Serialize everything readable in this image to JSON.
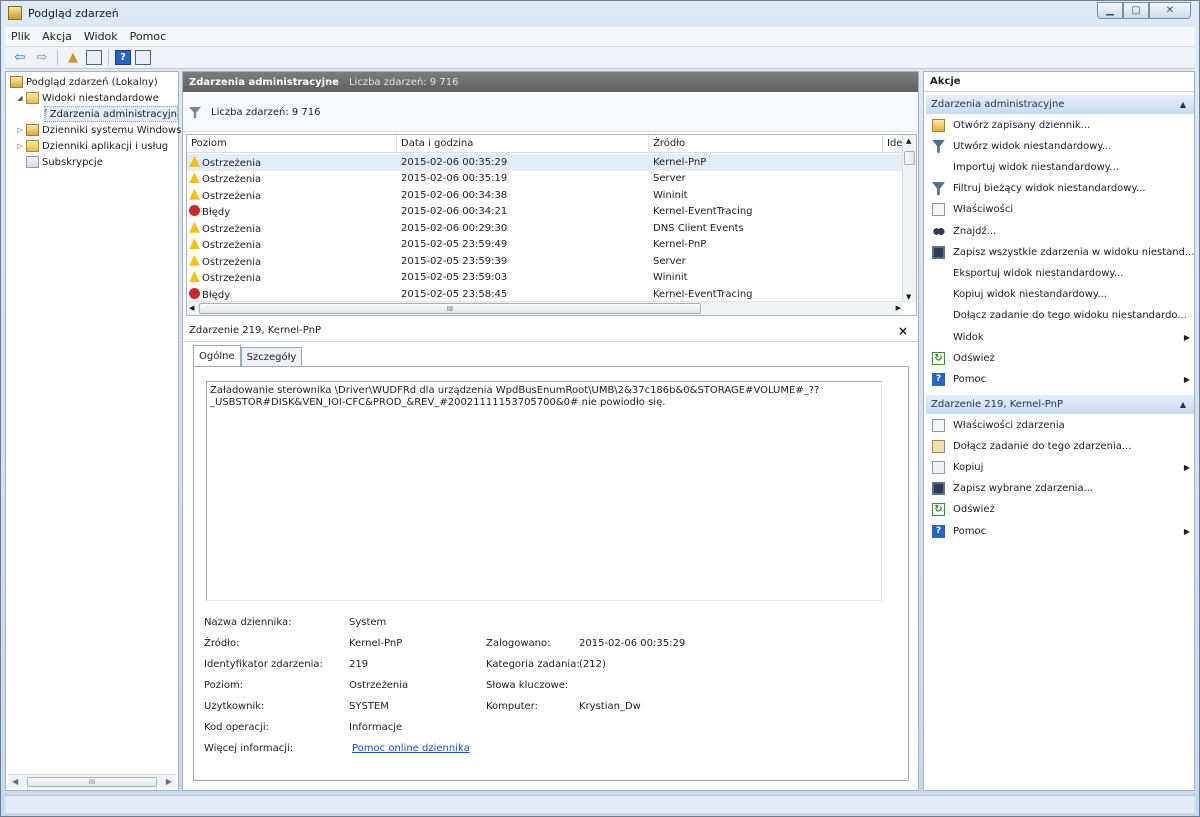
{
  "window": {
    "title": "Podgląd zdarzeń"
  },
  "menubar": [
    {
      "label": "Plik"
    },
    {
      "label": "Akcja"
    },
    {
      "label": "Widok"
    },
    {
      "label": "Pomoc"
    }
  ],
  "tree": {
    "root": "Podgląd zdarzeń (Lokalny)",
    "custom_views": "Widoki niestandardowe",
    "admin_events": "Zdarzenia administracyjn",
    "windows_logs": "Dzienniki systemu Windows",
    "app_logs": "Dzienniki aplikacji i usług",
    "subscriptions": "Subskrypcje",
    "scroll_thumb": "III"
  },
  "middle": {
    "header_title": "Zdarzenia administracyjne",
    "header_count": "Liczba zdarzeń: 9 716",
    "filter_count": "Liczba zdarzeń: 9 716"
  },
  "events": {
    "columns": [
      "Poziom",
      "Data i godzina",
      "Źródło",
      "Ide"
    ],
    "rows": [
      {
        "level": "Ostrzeżenia",
        "type": "warn",
        "date": "2015-02-06 00:35:29",
        "source": "Kernel-PnP"
      },
      {
        "level": "Ostrzeżenia",
        "type": "warn",
        "date": "2015-02-06 00:35:19",
        "source": "Server"
      },
      {
        "level": "Ostrzeżenia",
        "type": "warn",
        "date": "2015-02-06 00:34:38",
        "source": "Wininit"
      },
      {
        "level": "Błędy",
        "type": "err",
        "date": "2015-02-06 00:34:21",
        "source": "Kernel-EventTracing"
      },
      {
        "level": "Ostrzeżenia",
        "type": "warn",
        "date": "2015-02-06 00:29:30",
        "source": "DNS Client Events"
      },
      {
        "level": "Ostrzeżenia",
        "type": "warn",
        "date": "2015-02-05 23:59:49",
        "source": "Kernel-PnP"
      },
      {
        "level": "Ostrzeżenia",
        "type": "warn",
        "date": "2015-02-05 23:59:39",
        "source": "Server"
      },
      {
        "level": "Ostrzeżenia",
        "type": "warn",
        "date": "2015-02-05 23:59:03",
        "source": "Wininit"
      },
      {
        "level": "Błędy",
        "type": "err",
        "date": "2015-02-05 23:58:45",
        "source": "Kernel-EventTracing"
      }
    ],
    "hscroll_thumb": "III"
  },
  "detail": {
    "title": "Zdarzenie 219, Kernel-PnP",
    "close": "×",
    "tabs": [
      "Ogólne",
      "Szczegóły"
    ],
    "message_line1": "Załadowanie sterownika \\Driver\\WUDFRd dla urządzenia WpdBusEnumRoot\\UMB\\2&37c186b&0&STORAGE#VOLUME#_??",
    "message_line2": "_USBSTOR#DISK&VEN_IOI-CFC&PROD_&REV_#20021111153705700&0# nie powiodło się.",
    "labels": {
      "log_name": "Nazwa dziennika:",
      "source": "Źródło:",
      "event_id": "Identyfikator zdarzenia:",
      "level": "Poziom:",
      "user": "Użytkownik:",
      "opcode": "Kod operacji:",
      "more_info": "Więcej informacji:",
      "logged": "Zalogowano:",
      "task_category": "Kategoria zadania:",
      "keywords": "Słowa kluczowe:",
      "computer": "Komputer:"
    },
    "values": {
      "log_name": "System",
      "source": "Kernel-PnP",
      "event_id": "219",
      "level": "Ostrzeżenia",
      "user": "SYSTEM",
      "opcode": "Informacje",
      "more_info": "Pomoc online dziennika",
      "logged": "2015-02-06 00:35:29",
      "task_category": "(212)",
      "keywords": "",
      "computer": "Krystian_Dw"
    }
  },
  "actions": {
    "title": "Akcje",
    "group1": "Zdarzenia administracyjne",
    "group1_items": [
      {
        "label": "Otwórz zapisany dziennik...",
        "icon": "open-icon"
      },
      {
        "label": "Utwórz widok niestandardowy...",
        "icon": "filter-icon"
      },
      {
        "label": "Importuj widok niestandardowy...",
        "icon": "blank"
      },
      {
        "label": "Filtruj bieżący widok niestandardowy...",
        "icon": "filter-icon"
      },
      {
        "label": "Właściwości",
        "icon": "properties-icon"
      },
      {
        "label": "Znajdź...",
        "icon": "find-icon"
      },
      {
        "label": "Zapisz wszystkie zdarzenia w widoku niestand...",
        "icon": "save-icon"
      },
      {
        "label": "Eksportuj widok niestandardowy...",
        "icon": "blank"
      },
      {
        "label": "Kopiuj widok niestandardowy...",
        "icon": "blank"
      },
      {
        "label": "Dołącz zadanie do tego widoku niestandardo...",
        "icon": "blank"
      },
      {
        "label": "Widok",
        "icon": "blank",
        "submenu": true
      },
      {
        "label": "Odśwież",
        "icon": "refresh-icon"
      },
      {
        "label": "Pomoc",
        "icon": "help-icon",
        "submenu": true
      }
    ],
    "group2": "Zdarzenie 219, Kernel-PnP",
    "group2_items": [
      {
        "label": "Właściwości zdarzenia",
        "icon": "properties-icon"
      },
      {
        "label": "Dołącz zadanie do tego zdarzenia...",
        "icon": "task-icon"
      },
      {
        "label": "Kopiuj",
        "icon": "copy-icon",
        "submenu": true
      },
      {
        "label": "Zapisz wybrane zdarzenia...",
        "icon": "save-icon"
      },
      {
        "label": "Odśwież",
        "icon": "refresh-icon"
      },
      {
        "label": "Pomoc",
        "icon": "help-icon",
        "submenu": true
      }
    ]
  }
}
